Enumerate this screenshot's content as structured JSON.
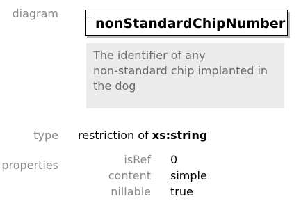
{
  "labels": {
    "diagram": "diagram",
    "type": "type",
    "properties": "properties"
  },
  "element": {
    "name": "nonStandardChipNumber",
    "annotation_lines": [
      "The identifier of any",
      "non-standard chip implanted in",
      "the dog"
    ]
  },
  "type": {
    "prefix": "restriction of ",
    "base": "xs:string"
  },
  "properties": [
    {
      "key": "isRef",
      "value": "0"
    },
    {
      "key": "content",
      "value": "simple"
    },
    {
      "key": "nillable",
      "value": "true"
    }
  ]
}
